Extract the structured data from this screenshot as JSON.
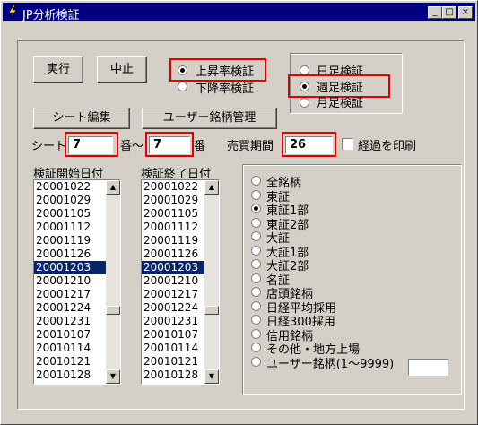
{
  "window": {
    "title": "JP分析検証",
    "minimize": "_",
    "maximize": "□",
    "close": "×"
  },
  "buttons": {
    "run": "実行",
    "stop": "中止",
    "sheet_edit": "シート編集",
    "user_stock": "ユーザー銘柄管理"
  },
  "mode": {
    "options": [
      "上昇率検証",
      "下降率検証"
    ],
    "selected": 0
  },
  "period_type": {
    "options": [
      "日足検証",
      "週足検証",
      "月足検証"
    ],
    "selected": 1
  },
  "sheet": {
    "label": "シート",
    "from": "7",
    "mid_label": "番～",
    "to": "7",
    "end_label": "番"
  },
  "trade": {
    "label": "売買期間",
    "value": "26",
    "print_label": "経過を印刷",
    "print_checked": false
  },
  "start_list": {
    "label": "検証開始日付",
    "items": [
      "20001022",
      "20001029",
      "20001105",
      "20001112",
      "20001119",
      "20001126",
      "20001203",
      "20001210",
      "20001217",
      "20001224",
      "20001231",
      "20010107",
      "20010114",
      "20010121",
      "20010128"
    ],
    "selected_index": 6
  },
  "end_list": {
    "label": "検証終了日付",
    "items": [
      "20001022",
      "20001029",
      "20001105",
      "20001112",
      "20001119",
      "20001126",
      "20001203",
      "20001210",
      "20001217",
      "20001224",
      "20001231",
      "20010107",
      "20010114",
      "20010121",
      "20010128"
    ],
    "selected_index": 6
  },
  "market": {
    "options": [
      "全銘柄",
      "東証",
      "東証1部",
      "東証2部",
      "大証",
      "大証1部",
      "大証2部",
      "名証",
      "店頭銘柄",
      "日経平均採用",
      "日経300採用",
      "信用銘柄",
      "その他・地方上場",
      "ユーザー銘柄(1～9999)"
    ],
    "selected": 2,
    "user_input": ""
  },
  "colors": {
    "title_bar": "#000080",
    "highlight": "#e00000",
    "selection": "#0a246a",
    "face": "#d4d0c8"
  }
}
